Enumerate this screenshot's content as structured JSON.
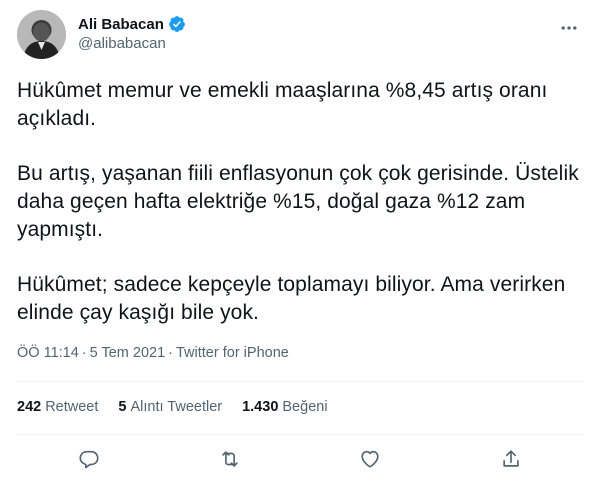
{
  "tweet": {
    "author": {
      "display_name": "Ali Babacan",
      "handle": "@alibabacan",
      "verified": true
    },
    "paragraphs": [
      "Hükûmet memur ve emekli maaşlarına %8,45 artış oranı açıkladı.",
      "Bu artış, yaşanan fiili enflasyonun çok çok gerisinde. Üstelik daha geçen hafta elektriğe %15, doğal gaza %12 zam yapmıştı.",
      "Hükûmet; sadece kepçeyle toplamayı biliyor. Ama verirken elinde çay kaşığı bile yok."
    ],
    "meta": {
      "time": "ÖÖ 11:14",
      "separator": "·",
      "date": "5 Tem 2021",
      "source": "Twitter for iPhone"
    },
    "stats": {
      "retweets": {
        "count": "242",
        "label": "Retweet"
      },
      "quotes": {
        "count": "5",
        "label": "Alıntı Tweetler"
      },
      "likes": {
        "count": "1.430",
        "label": "Beğeni"
      }
    },
    "actions": [
      "reply-icon",
      "retweet-icon",
      "like-icon",
      "share-icon"
    ]
  },
  "colors": {
    "text": "#0f1419",
    "secondary": "#536471",
    "verified": "#1d9bf0",
    "divider": "#eff3f4"
  }
}
